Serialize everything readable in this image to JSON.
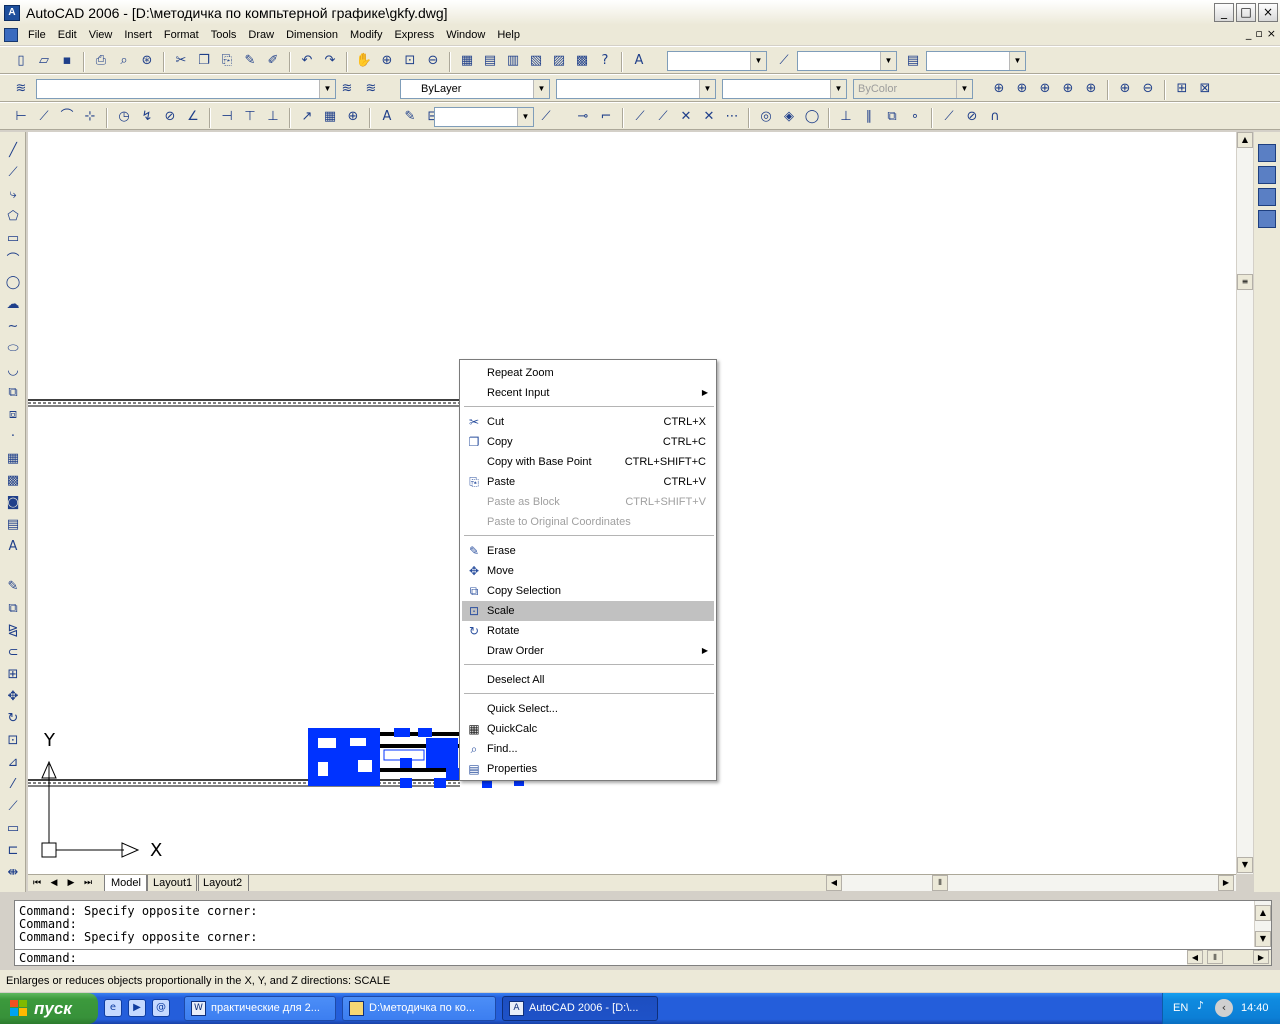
{
  "window": {
    "title": "AutoCAD 2006 - [D:\\методичка по компьтерной графике\\gkfy.dwg]",
    "min_glyph": "_",
    "max_glyph": "□",
    "close_glyph": "×"
  },
  "menu": {
    "items": [
      "File",
      "Edit",
      "View",
      "Insert",
      "Format",
      "Tools",
      "Draw",
      "Dimension",
      "Modify",
      "Express",
      "Window",
      "Help"
    ],
    "mdi_glyphs": [
      "_",
      "▫",
      "×"
    ]
  },
  "toolbars": {
    "layer_combo_value": "",
    "color_combo_value": "ByLayer",
    "linetype_combo_value": "",
    "lineweight_combo_value": "",
    "plotstyle_combo_value": "ByColor",
    "textstyle_combo_value": "",
    "dimstyle_combo_value": "",
    "tablestyle_combo_value": "",
    "dimstyle2_combo_value": ""
  },
  "tabs": {
    "items": [
      "Model",
      "Layout1",
      "Layout2"
    ],
    "active": "Model"
  },
  "command": {
    "lines": [
      "Command: Specify opposite corner:",
      "Command:",
      "Command: Specify opposite corner:"
    ],
    "prompt": "Command:"
  },
  "status": {
    "text": "Enlarges or reduces objects proportionally in the X, Y, and Z directions:  SCALE"
  },
  "ucs": {
    "x_label": "X",
    "y_label": "Y"
  },
  "context_menu": {
    "items": [
      {
        "label": "Repeat Zoom",
        "shortcut": "",
        "icon": "",
        "disabled": false,
        "submenu": false
      },
      {
        "label": "Recent Input",
        "shortcut": "",
        "icon": "",
        "disabled": false,
        "submenu": true
      },
      {
        "label": "Cut",
        "shortcut": "CTRL+X",
        "icon": "cut-icon",
        "disabled": false,
        "submenu": false
      },
      {
        "label": "Copy",
        "shortcut": "CTRL+C",
        "icon": "copy-icon",
        "disabled": false,
        "submenu": false
      },
      {
        "label": "Copy with Base Point",
        "shortcut": "CTRL+SHIFT+C",
        "icon": "",
        "disabled": false,
        "submenu": false
      },
      {
        "label": "Paste",
        "shortcut": "CTRL+V",
        "icon": "paste-icon",
        "disabled": false,
        "submenu": false
      },
      {
        "label": "Paste as Block",
        "shortcut": "CTRL+SHIFT+V",
        "icon": "",
        "disabled": true,
        "submenu": false
      },
      {
        "label": "Paste to Original Coordinates",
        "shortcut": "",
        "icon": "",
        "disabled": true,
        "submenu": false
      },
      {
        "label": "Erase",
        "shortcut": "",
        "icon": "erase-icon",
        "disabled": false,
        "submenu": false
      },
      {
        "label": "Move",
        "shortcut": "",
        "icon": "move-icon",
        "disabled": false,
        "submenu": false
      },
      {
        "label": "Copy Selection",
        "shortcut": "",
        "icon": "copy-selection-icon",
        "disabled": false,
        "submenu": false
      },
      {
        "label": "Scale",
        "shortcut": "",
        "icon": "scale-icon",
        "disabled": false,
        "submenu": false,
        "highlighted": true
      },
      {
        "label": "Rotate",
        "shortcut": "",
        "icon": "rotate-icon",
        "disabled": false,
        "submenu": false
      },
      {
        "label": "Draw Order",
        "shortcut": "",
        "icon": "",
        "disabled": false,
        "submenu": true
      },
      {
        "label": "Deselect All",
        "shortcut": "",
        "icon": "",
        "disabled": false,
        "submenu": false
      },
      {
        "label": "Quick Select...",
        "shortcut": "",
        "icon": "",
        "disabled": false,
        "submenu": false
      },
      {
        "label": "QuickCalc",
        "shortcut": "",
        "icon": "calculator-icon",
        "disabled": false,
        "submenu": false
      },
      {
        "label": "Find...",
        "shortcut": "",
        "icon": "find-icon",
        "disabled": false,
        "submenu": false
      },
      {
        "label": "Properties",
        "shortcut": "",
        "icon": "properties-icon",
        "disabled": false,
        "submenu": false
      }
    ]
  },
  "taskbar": {
    "start_label": "пуск",
    "buttons": [
      {
        "label": "практические для 2...",
        "icon": "word-icon",
        "active": false
      },
      {
        "label": "D:\\методичка по ко...",
        "icon": "folder-icon",
        "active": false
      },
      {
        "label": "AutoCAD 2006 - [D:\\...",
        "icon": "autocad-icon",
        "active": true
      }
    ],
    "lang": "EN",
    "clock": "14:40"
  },
  "colors": {
    "selection_blue": "#0033ff",
    "menu_highlight": "#c1c1c1",
    "taskbar_blue": "#245edb"
  }
}
